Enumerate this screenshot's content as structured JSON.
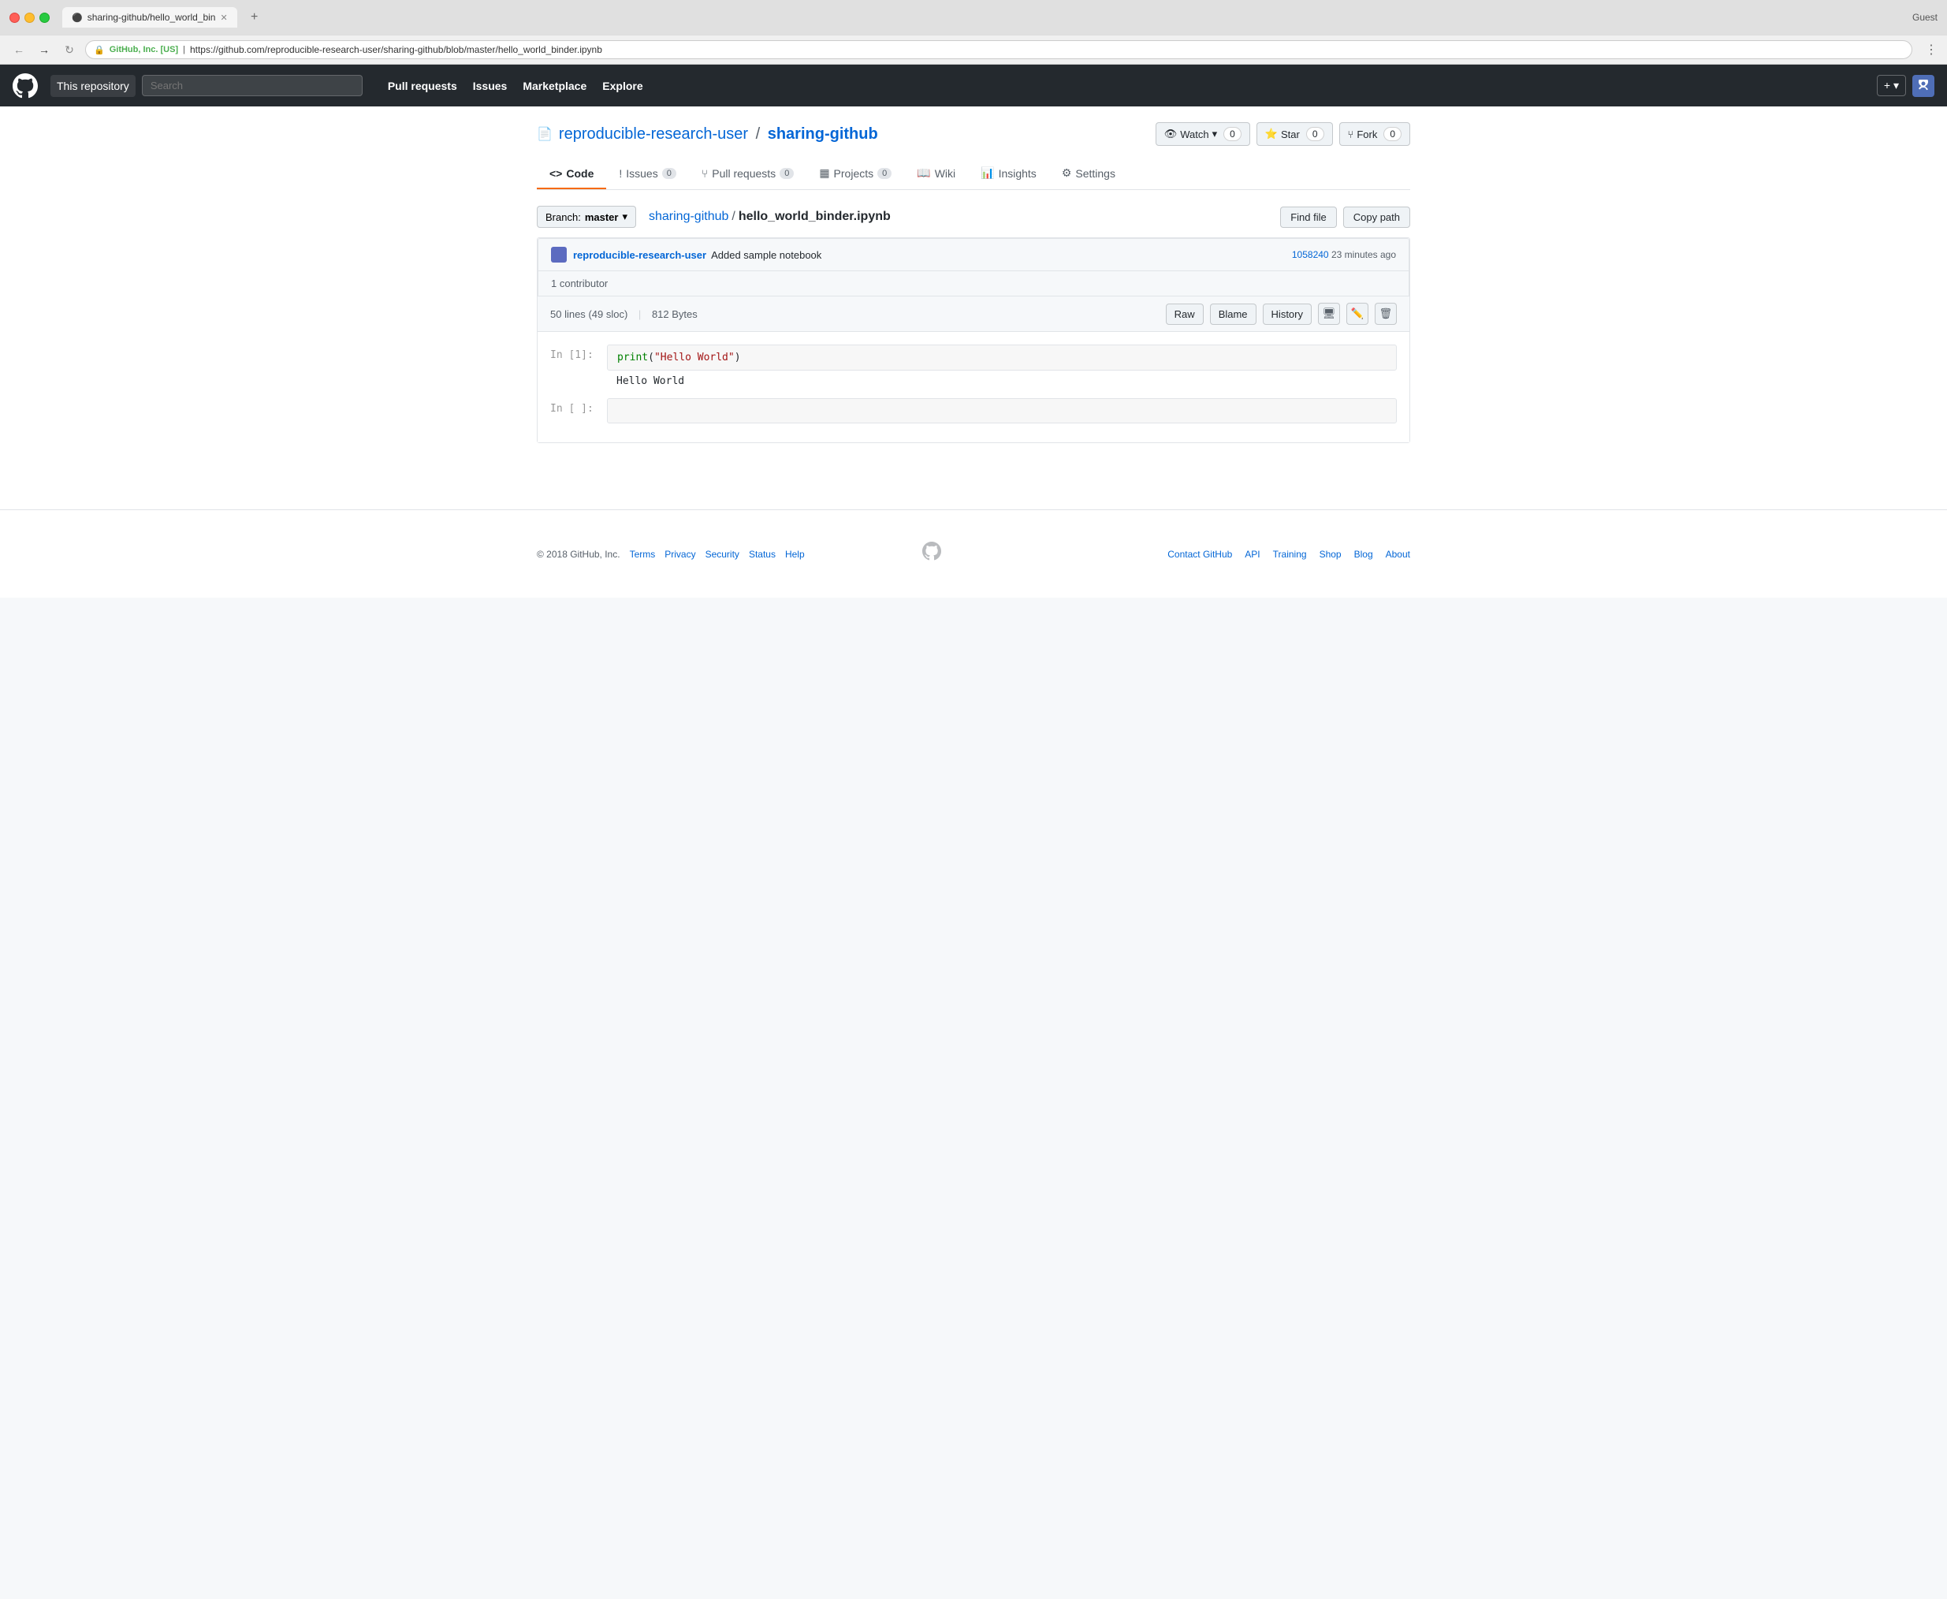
{
  "browser": {
    "tab_title": "sharing-github/hello_world_bin",
    "url_secure_label": "GitHub, Inc. [US]",
    "url": "https://github.com/reproducible-research-user/sharing-github/blob/master/hello_world_binder.ipynb",
    "guest_label": "Guest"
  },
  "header": {
    "this_repo_label": "This repository",
    "search_placeholder": "Search",
    "nav": {
      "pull_requests": "Pull requests",
      "issues": "Issues",
      "marketplace": "Marketplace",
      "explore": "Explore"
    }
  },
  "repo": {
    "icon": "📄",
    "owner": "reproducible-research-user",
    "separator": "/",
    "name": "sharing-github",
    "watch_label": "Watch",
    "watch_count": "0",
    "star_label": "Star",
    "star_count": "0",
    "fork_label": "Fork",
    "fork_count": "0"
  },
  "tabs": [
    {
      "label": "Code",
      "icon": "<>",
      "active": true,
      "badge": null
    },
    {
      "label": "Issues",
      "icon": "!",
      "active": false,
      "badge": "0"
    },
    {
      "label": "Pull requests",
      "icon": "⑂",
      "active": false,
      "badge": "0"
    },
    {
      "label": "Projects",
      "icon": "▦",
      "active": false,
      "badge": "0"
    },
    {
      "label": "Wiki",
      "icon": "📖",
      "active": false,
      "badge": null
    },
    {
      "label": "Insights",
      "icon": "📊",
      "active": false,
      "badge": null
    },
    {
      "label": "Settings",
      "icon": "⚙",
      "active": false,
      "badge": null
    }
  ],
  "file_nav": {
    "branch_label": "Branch:",
    "branch_name": "master",
    "repo_path": "sharing-github",
    "path_sep": "/",
    "file_name": "hello_world_binder.ipynb",
    "find_file_label": "Find file",
    "copy_path_label": "Copy path"
  },
  "file_info": {
    "author": "reproducible-research-user",
    "commit_msg": "Added sample notebook",
    "commit_sha": "1058240",
    "commit_time": "23 minutes ago",
    "contributors_label": "1 contributor"
  },
  "file_content": {
    "lines": "50 lines",
    "sloc": "(49 sloc)",
    "size": "812 Bytes",
    "raw_label": "Raw",
    "blame_label": "Blame",
    "history_label": "History"
  },
  "notebook": {
    "cell1_label": "In [1]:",
    "cell1_code_fn": "print",
    "cell1_code_open": "(",
    "cell1_code_str": "\"Hello World\"",
    "cell1_code_close": ")",
    "cell1_output": "Hello World",
    "cell2_label": "In [ ]:"
  },
  "footer": {
    "copyright": "© 2018 GitHub, Inc.",
    "links": [
      "Terms",
      "Privacy",
      "Security",
      "Status",
      "Help"
    ],
    "right_links": [
      "Contact GitHub",
      "API",
      "Training",
      "Shop",
      "Blog",
      "About"
    ]
  }
}
